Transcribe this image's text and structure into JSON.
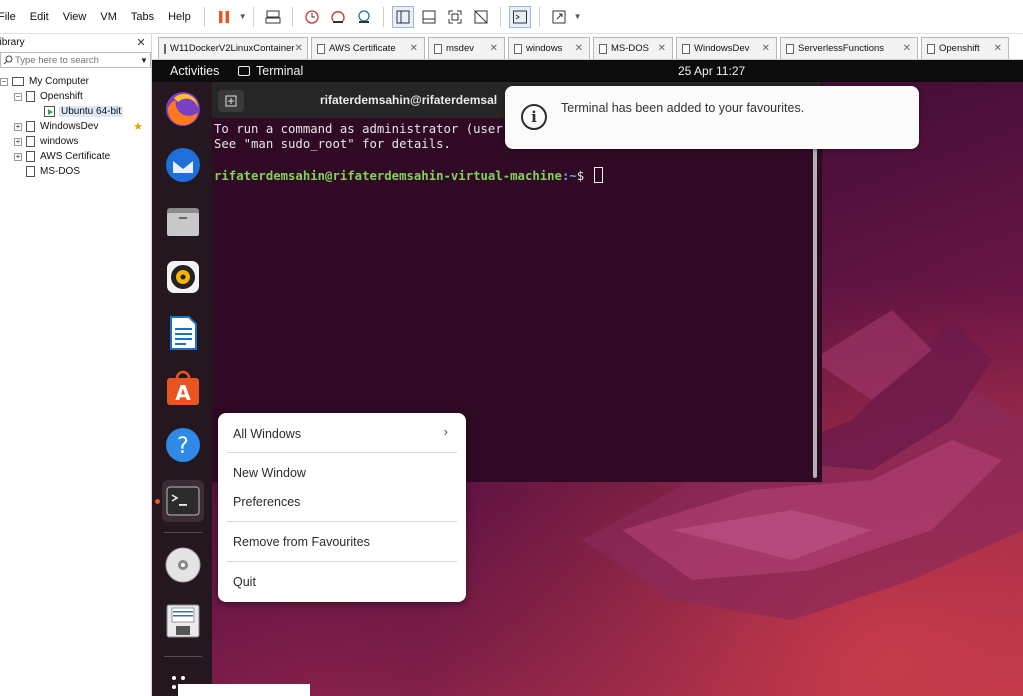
{
  "menubar": {
    "items": [
      "File",
      "Edit",
      "View",
      "VM",
      "Tabs",
      "Help"
    ]
  },
  "library": {
    "title": "Library",
    "search_placeholder": "Type here to search",
    "tree": {
      "root": "My Computer",
      "openshift": "Openshift",
      "ubuntu": "Ubuntu 64-bit",
      "windowsdev": "WindowsDev",
      "windows": "windows",
      "aws": "AWS Certificate",
      "msdos": "MS-DOS"
    }
  },
  "tabs": [
    {
      "label": "W11DockerV2LinuxContainer"
    },
    {
      "label": "AWS Certificate"
    },
    {
      "label": "msdev"
    },
    {
      "label": "windows"
    },
    {
      "label": "MS-DOS"
    },
    {
      "label": "WindowsDev"
    },
    {
      "label": "ServerlessFunctions"
    },
    {
      "label": "Openshift"
    }
  ],
  "gnome": {
    "activities": "Activities",
    "app_name": "Terminal",
    "clock": "25 Apr  11:27"
  },
  "terminal": {
    "title": "rifaterdemsahin@rifaterdemsal",
    "line1": "To run a command as administrator (user",
    "line2": "See \"man sudo_root\" for details.",
    "prompt_user": "rifaterdemsahin@rifaterdemsahin-virtual-machine",
    "prompt_path": ":~",
    "prompt_symbol": "$"
  },
  "notification": {
    "message": "Terminal has been added to your favourites."
  },
  "context_menu": {
    "all_windows": "All Windows",
    "new_window": "New Window",
    "preferences": "Preferences",
    "remove_favourites": "Remove from Favourites",
    "quit": "Quit"
  },
  "dock": {
    "items": [
      "firefox-icon",
      "thunderbird-icon",
      "files-icon",
      "rhythmbox-icon",
      "writer-icon",
      "software-icon",
      "help-icon",
      "terminal-icon",
      "disc-icon",
      "floppy-icon",
      "apps-grid-icon"
    ]
  },
  "colors": {
    "ubuntu_orange": "#e95420",
    "terminal_bg": "#300a24",
    "prompt_green": "#7fd455",
    "prompt_blue": "#7aa7e0"
  }
}
